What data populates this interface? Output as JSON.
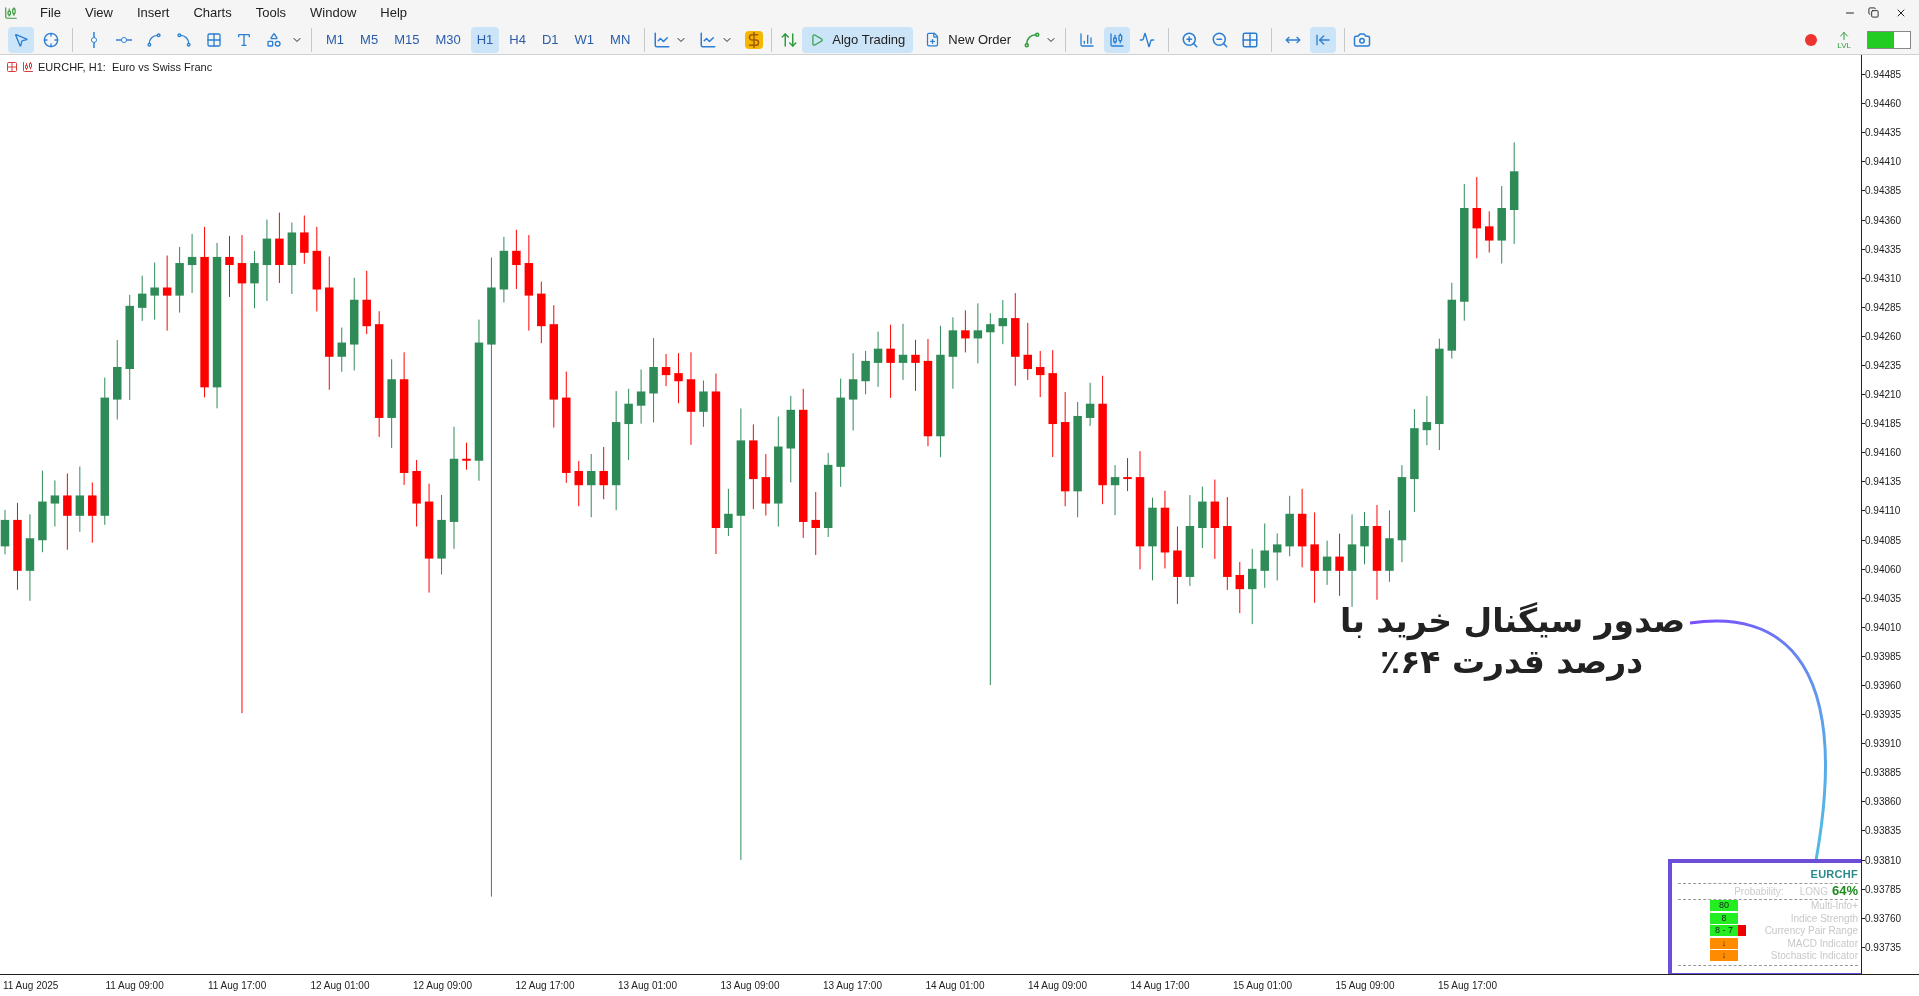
{
  "menu": [
    "File",
    "View",
    "Insert",
    "Charts",
    "Tools",
    "Window",
    "Help"
  ],
  "tools": [
    {
      "kind": "cursor",
      "selected": true
    },
    {
      "kind": "crosshair",
      "selected": false
    },
    {
      "kind": "vline",
      "selected": false
    },
    {
      "kind": "hline",
      "selected": false
    },
    {
      "kind": "trend",
      "selected": false
    },
    {
      "kind": "channel",
      "selected": false
    },
    {
      "kind": "fibo",
      "selected": false
    },
    {
      "kind": "text",
      "selected": false
    },
    {
      "kind": "shapes",
      "selected": false
    }
  ],
  "timeframes": [
    {
      "label": "M1",
      "selected": false
    },
    {
      "label": "M5",
      "selected": false
    },
    {
      "label": "M15",
      "selected": false
    },
    {
      "label": "M30",
      "selected": false
    },
    {
      "label": "H1",
      "selected": true
    },
    {
      "label": "H4",
      "selected": false
    },
    {
      "label": "D1",
      "selected": false
    },
    {
      "label": "W1",
      "selected": false
    },
    {
      "label": "MN",
      "selected": false
    }
  ],
  "actions": [
    {
      "kind": "algo",
      "label": "Algo Trading",
      "selected": true
    },
    {
      "kind": "order",
      "label": "New Order",
      "selected": false
    }
  ],
  "chart_types": [
    {
      "kind": "bars",
      "selected": false
    },
    {
      "kind": "candles",
      "selected": true
    },
    {
      "kind": "line",
      "selected": false
    }
  ],
  "scroll_tools": [
    {
      "kind": "shift",
      "selected": false
    },
    {
      "kind": "autoscroll",
      "selected": true
    }
  ],
  "level_label": "LVL",
  "chart": {
    "title": "EURCHF, H1:  Euro vs Swiss Franc",
    "price_labels": [
      "0.94485",
      "0.94460",
      "0.94435",
      "0.94410",
      "0.94385",
      "0.94360",
      "0.94335",
      "0.94310",
      "0.94285",
      "0.94260",
      "0.94235",
      "0.94210",
      "0.94185",
      "0.94160",
      "0.94135",
      "0.94110",
      "0.94085",
      "0.94060",
      "0.94035",
      "0.94010",
      "0.93985",
      "0.93960",
      "0.93935",
      "0.93910",
      "0.93885",
      "0.93860",
      "0.93835",
      "0.93810",
      "0.93785",
      "0.93760",
      "0.93735"
    ],
    "time_labels": [
      "11 Aug 2025",
      "11 Aug 09:00",
      "11 Aug 17:00",
      "12 Aug 01:00",
      "12 Aug 09:00",
      "12 Aug 17:00",
      "13 Aug 01:00",
      "13 Aug 09:00",
      "13 Aug 17:00",
      "14 Aug 01:00",
      "14 Aug 09:00",
      "14 Aug 17:00",
      "15 Aug 01:00",
      "15 Aug 09:00",
      "15 Aug 17:00"
    ]
  },
  "annotation": {
    "lines": [
      "صدور سیگنال خرید با",
      "درصد قدرت ۶۴٪"
    ]
  },
  "panel": {
    "symbol": "EURCHF",
    "probability_label": "Probability:",
    "direction": "LONG",
    "percent": "64%",
    "rows": [
      {
        "label": "Multi-Info+",
        "value": "80",
        "color": "#22ee22",
        "flag": false
      },
      {
        "label": "Indice Strength",
        "value": "8",
        "color": "#22ee22",
        "flag": false
      },
      {
        "label": "Currency Pair Range",
        "value": "8 - 7",
        "color": "#22ee22",
        "flag": true
      },
      {
        "label": "MACD Indicator",
        "value": "↓",
        "color": "#ff8c00",
        "flag": false
      },
      {
        "label": "Stochastic Indicator",
        "value": "↓",
        "color": "#ff8c00",
        "flag": false
      }
    ]
  }
}
